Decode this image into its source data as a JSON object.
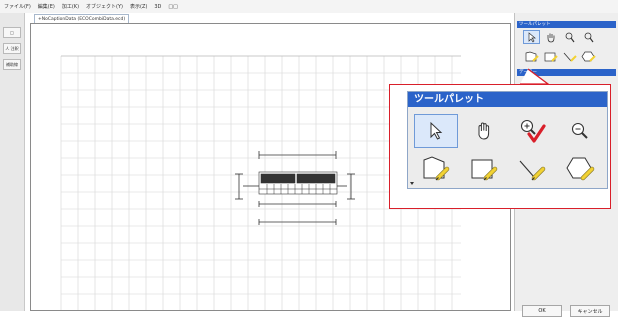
{
  "menu": [
    "ファイル(F)",
    "編集(E)",
    "加工(K)",
    "オブジェクト(Y)",
    "表示(Z)",
    "3D",
    "□□"
  ],
  "left_toolbar": [
    "□",
    "人 注釈",
    "補助線"
  ],
  "tab": {
    "label": "+NoCaptionData (ECOCombiData.ecd)"
  },
  "palette": {
    "title": "ツールパレット",
    "tools": [
      {
        "name": "select-tool",
        "icon": "arrow-cursor-icon",
        "selected": true
      },
      {
        "name": "hand-tool",
        "icon": "hand-icon",
        "selected": false
      },
      {
        "name": "zoom-in-tool",
        "icon": "zoom-in-icon",
        "selected": false
      },
      {
        "name": "zoom-out-tool",
        "icon": "zoom-out-icon",
        "selected": false
      },
      {
        "name": "polygon-room-tool",
        "icon": "polygon-pencil-icon",
        "selected": false
      },
      {
        "name": "rectangle-tool",
        "icon": "rectangle-pencil-icon",
        "selected": false
      },
      {
        "name": "line-tool",
        "icon": "line-pencil-icon",
        "selected": false
      },
      {
        "name": "hexagon-tool",
        "icon": "hexagon-pencil-icon",
        "selected": false
      }
    ]
  },
  "right_panel": {
    "title_1": "ツールパレット",
    "title_2": "データー",
    "ok_label": "OK",
    "cancel_label": "キャンセル"
  },
  "colors": {
    "title_bar": "#2b63c9",
    "callout_border": "#d91f2a",
    "checkmark": "#d91f2a",
    "pencil": "#f2d233",
    "selected_tool_bg": "#dbe8fa"
  }
}
